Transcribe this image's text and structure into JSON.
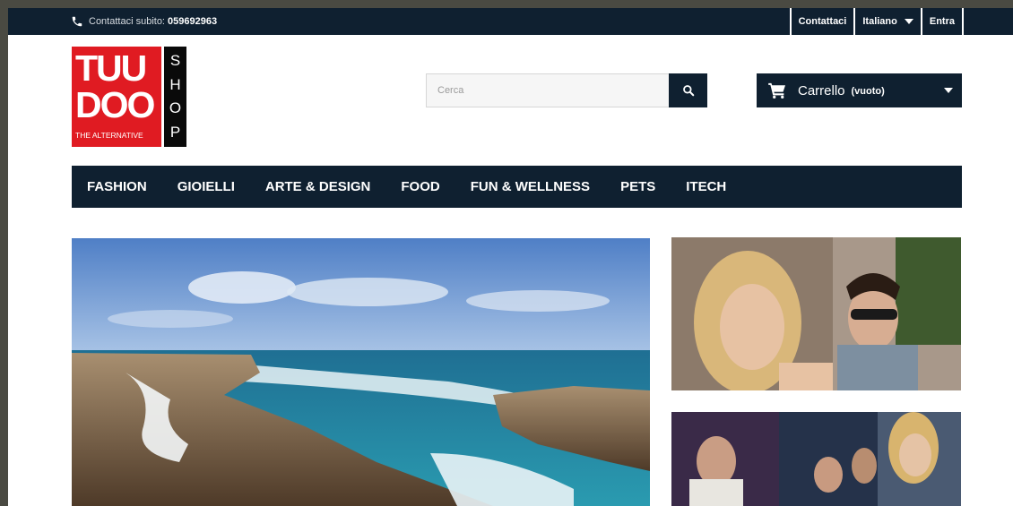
{
  "topbar": {
    "contact_label": "Contattaci subito:",
    "phone": "059692963",
    "links": {
      "contacts": "Contattaci",
      "language": "Italiano",
      "login": "Entra"
    }
  },
  "logo": {
    "line1": "TUU",
    "line2": "DOO",
    "tagline": "THE ALTERNATIVE",
    "shop_letters": [
      "S",
      "H",
      "O",
      "P"
    ]
  },
  "search": {
    "placeholder": "Cerca",
    "icon": "search-icon"
  },
  "cart": {
    "label": "Carrello",
    "status": "(vuoto)",
    "icon": "cart-icon"
  },
  "nav": {
    "items": [
      "FASHION",
      "GIOIELLI",
      "ARTE & DESIGN",
      "FOOD",
      "FUN & WELLNESS",
      "PETS",
      "ITECH"
    ]
  },
  "colors": {
    "navy": "#0f2030",
    "brand_red": "#e01b22",
    "page_bg": "#ffffff"
  }
}
